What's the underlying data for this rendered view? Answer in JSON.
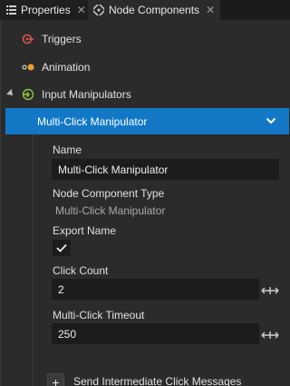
{
  "tabs": [
    {
      "label": "Properties",
      "icon": "list-icon",
      "close": "✕"
    },
    {
      "label": "Node Components",
      "icon": "components-icon",
      "close": "✕"
    }
  ],
  "tree": {
    "triggers": {
      "label": "Triggers",
      "icon": "trigger-icon"
    },
    "animation": {
      "label": "Animation",
      "icon": "animation-icon"
    },
    "input_manipulators": {
      "label": "Input Manipulators",
      "icon": "input-manipulator-icon"
    },
    "selected": {
      "label": "Multi-Click Manipulator",
      "icon": "chevron-down-icon"
    }
  },
  "properties": {
    "name_label": "Name",
    "name_value": "Multi-Click Manipulator",
    "type_label": "Node Component Type",
    "type_value": "Multi-Click Manipulator",
    "export_label": "Export Name",
    "export_checked": true,
    "click_count_label": "Click Count",
    "click_count_value": "2",
    "timeout_label": "Multi-Click Timeout",
    "timeout_value": "250",
    "add_label": "Send Intermediate Click Messages",
    "add_symbol": "+"
  },
  "colors": {
    "selection": "#1278c6",
    "background": "#2b2b2b",
    "field": "#1c1c1c",
    "trigger_red": "#d9534f",
    "animation_orange": "#f0a030",
    "input_green": "#8cc63f"
  }
}
